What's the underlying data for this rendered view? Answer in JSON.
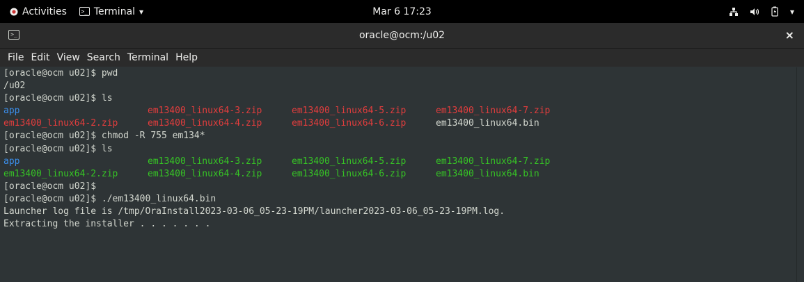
{
  "topbar": {
    "activities": "Activities",
    "app_menu": "Terminal",
    "clock": "Mar 6  17:23"
  },
  "window": {
    "title": "oracle@ocm:/u02",
    "close": "×"
  },
  "menu": [
    "File",
    "Edit",
    "View",
    "Search",
    "Terminal",
    "Help"
  ],
  "colors": {
    "dir": "#3b8eea",
    "zip": "#e33d3d",
    "exec": "#36c425",
    "text": "#d3d7cf"
  },
  "terminal": {
    "lines": [
      [
        {
          "t": "[oracle@ocm u02]$ pwd",
          "c": "text"
        }
      ],
      [
        {
          "t": "/u02",
          "c": "text"
        }
      ],
      [
        {
          "t": "[oracle@ocm u02]$ ls",
          "c": "text"
        }
      ],
      [
        {
          "t": "app",
          "c": "dir",
          "cell": true
        },
        {
          "t": "em13400_linux64-3.zip",
          "c": "zip",
          "cell": true
        },
        {
          "t": "em13400_linux64-5.zip",
          "c": "zip",
          "cell": true
        },
        {
          "t": "em13400_linux64-7.zip",
          "c": "zip"
        }
      ],
      [
        {
          "t": "em13400_linux64-2.zip",
          "c": "zip",
          "cell": true
        },
        {
          "t": "em13400_linux64-4.zip",
          "c": "zip",
          "cell": true
        },
        {
          "t": "em13400_linux64-6.zip",
          "c": "zip",
          "cell": true
        },
        {
          "t": "em13400_linux64.bin",
          "c": "text"
        }
      ],
      [
        {
          "t": "[oracle@ocm u02]$ chmod -R 755 em134*",
          "c": "text"
        }
      ],
      [
        {
          "t": "[oracle@ocm u02]$ ls",
          "c": "text"
        }
      ],
      [
        {
          "t": "app",
          "c": "dir",
          "cell": true
        },
        {
          "t": "em13400_linux64-3.zip",
          "c": "exec",
          "cell": true
        },
        {
          "t": "em13400_linux64-5.zip",
          "c": "exec",
          "cell": true
        },
        {
          "t": "em13400_linux64-7.zip",
          "c": "exec"
        }
      ],
      [
        {
          "t": "em13400_linux64-2.zip",
          "c": "exec",
          "cell": true
        },
        {
          "t": "em13400_linux64-4.zip",
          "c": "exec",
          "cell": true
        },
        {
          "t": "em13400_linux64-6.zip",
          "c": "exec",
          "cell": true
        },
        {
          "t": "em13400_linux64.bin",
          "c": "exec"
        }
      ],
      [
        {
          "t": "[oracle@ocm u02]$",
          "c": "text"
        }
      ],
      [
        {
          "t": "[oracle@ocm u02]$ ./em13400_linux64.bin",
          "c": "text"
        }
      ],
      [
        {
          "t": "Launcher log file is /tmp/OraInstall2023-03-06_05-23-19PM/launcher2023-03-06_05-23-19PM.log.",
          "c": "text"
        }
      ],
      [
        {
          "t": "Extracting the installer . . . . . . .",
          "c": "text"
        }
      ]
    ]
  }
}
